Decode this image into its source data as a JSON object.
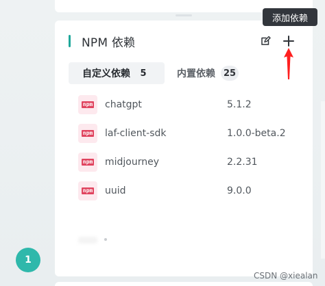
{
  "panel": {
    "title": "NPM 依赖",
    "tooltip": "添加依赖"
  },
  "tabs": [
    {
      "label": "自定义依赖",
      "count": "5"
    },
    {
      "label": "内置依赖",
      "count": "25"
    }
  ],
  "icon_label": "npm",
  "packages": [
    {
      "name": "chatgpt",
      "version": "5.1.2"
    },
    {
      "name": "laf-client-sdk",
      "version": "1.0.0-beta.2"
    },
    {
      "name": "midjourney",
      "version": "2.2.31"
    },
    {
      "name": "uuid",
      "version": "9.0.0"
    }
  ],
  "page_badge": "1",
  "watermark": "CSDN @xiealan",
  "colors": {
    "accent": "#1ea79a",
    "badge": "#2fb8ab",
    "npm": "#e0445f",
    "arrow": "#ff1f1f"
  },
  "icons": [
    "edit-icon",
    "plus-icon",
    "npm-icon",
    "red-arrow-annotation"
  ]
}
